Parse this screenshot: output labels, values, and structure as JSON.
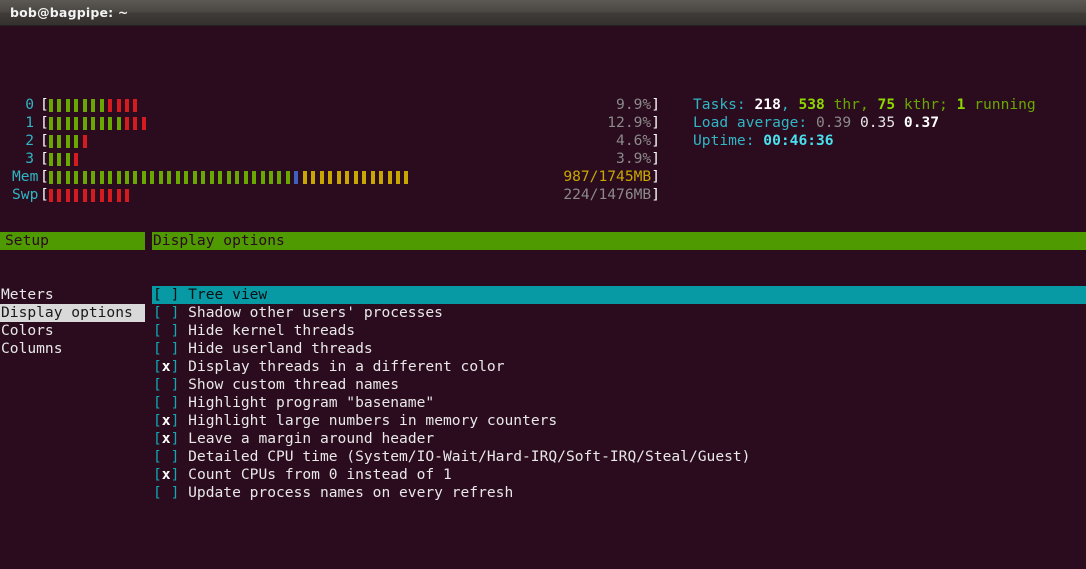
{
  "window": {
    "title": "bob@bagpipe: ~"
  },
  "colors": {
    "background": "#2b0b1e",
    "header_green": "#4e9a00",
    "selection_teal": "#089aa4",
    "sidebar_selection": "#d9d9d9",
    "cpu_normal": "#69a800",
    "cpu_kernel": "#d41c20",
    "mem_used": "#69a800",
    "mem_buffers": "#4060c0",
    "mem_cache": "#c8a800",
    "label_cyan": "#2fb6c4",
    "dim_text": "#8a8a8a"
  },
  "header": {
    "cpu_meters": [
      {
        "label": "0",
        "value": "9.9%",
        "green_bars": 7,
        "red_bars": 4
      },
      {
        "label": "1",
        "value": "12.9%",
        "green_bars": 9,
        "red_bars": 3
      },
      {
        "label": "2",
        "value": "4.6%",
        "green_bars": 4,
        "red_bars": 1
      },
      {
        "label": "3",
        "value": "3.9%",
        "green_bars": 3,
        "red_bars": 1
      }
    ],
    "mem_meter": {
      "label": "Mem",
      "value": "987/1745MB",
      "used_bars": 29,
      "buffer_bars": 1,
      "cache_bars": 13
    },
    "swap_meter": {
      "label": "Swp",
      "value": "224/1476MB",
      "red_bars": 10
    },
    "stats": {
      "tasks_label": "Tasks: ",
      "tasks_count": "218",
      "tasks_sep1": ", ",
      "threads_count": "538",
      "threads_label": " thr, ",
      "kthreads_count": "75",
      "kthreads_label": " kthr; ",
      "running_count": "1",
      "running_label": " running",
      "load_label": "Load average: ",
      "load_1": "0.39",
      "load_5": "0.35",
      "load_15": "0.37",
      "uptime_label": "Uptime: ",
      "uptime_value": "00:46:36"
    }
  },
  "sidebar": {
    "header": "Setup",
    "items": [
      {
        "label": "Meters",
        "selected": false
      },
      {
        "label": "Display options",
        "selected": true
      },
      {
        "label": "Colors",
        "selected": false
      },
      {
        "label": "Columns",
        "selected": false
      }
    ]
  },
  "options_panel": {
    "header": "Display options",
    "rows": [
      {
        "checked": false,
        "label": "Tree view",
        "selected": true
      },
      {
        "checked": false,
        "label": "Shadow other users' processes",
        "selected": false
      },
      {
        "checked": false,
        "label": "Hide kernel threads",
        "selected": false
      },
      {
        "checked": false,
        "label": "Hide userland threads",
        "selected": false
      },
      {
        "checked": true,
        "label": "Display threads in a different color",
        "selected": false
      },
      {
        "checked": false,
        "label": "Show custom thread names",
        "selected": false
      },
      {
        "checked": false,
        "label": "Highlight program \"basename\"",
        "selected": false
      },
      {
        "checked": true,
        "label": "Highlight large numbers in memory counters",
        "selected": false
      },
      {
        "checked": true,
        "label": "Leave a margin around header",
        "selected": false
      },
      {
        "checked": false,
        "label": "Detailed CPU time (System/IO-Wait/Hard-IRQ/Soft-IRQ/Steal/Guest)",
        "selected": false
      },
      {
        "checked": true,
        "label": "Count CPUs from 0 instead of 1",
        "selected": false
      },
      {
        "checked": false,
        "label": "Update process names on every refresh",
        "selected": false
      }
    ]
  }
}
